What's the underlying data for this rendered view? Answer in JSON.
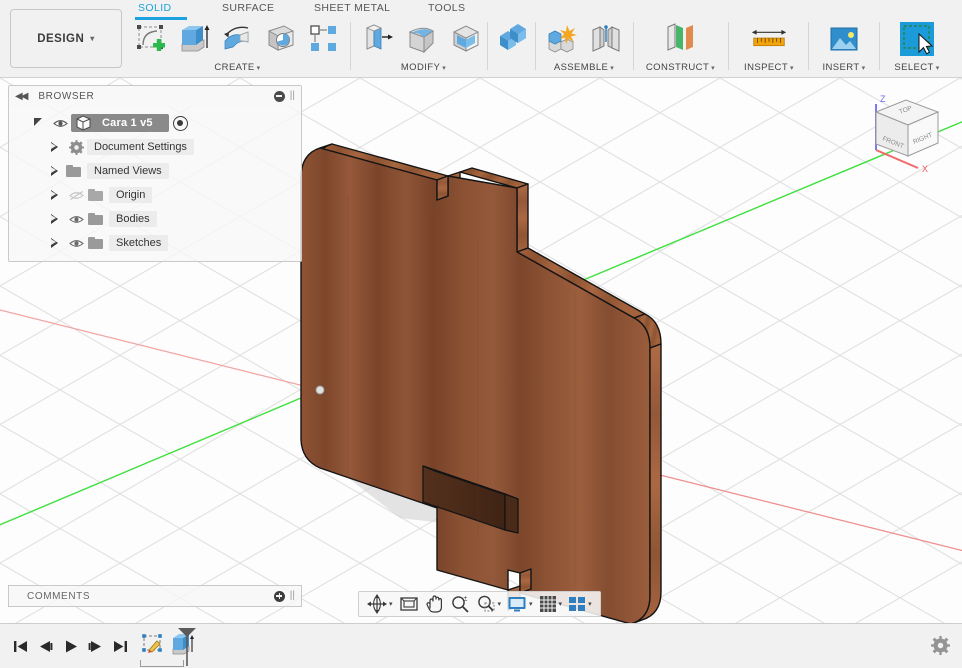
{
  "app": {
    "design_button_label": "DESIGN",
    "caret": "▾"
  },
  "ribbon": {
    "tabs": [
      {
        "label": "SOLID",
        "active": true
      },
      {
        "label": "SURFACE",
        "active": false
      },
      {
        "label": "SHEET METAL",
        "active": false
      },
      {
        "label": "TOOLS",
        "active": false
      }
    ],
    "groups": [
      {
        "label": "CREATE",
        "caret": "▾",
        "icons": [
          "create-sketch-icon",
          "extrude-icon",
          "revolve-icon",
          "sweep-icon",
          "pattern-icon"
        ]
      },
      {
        "label": "MODIFY",
        "caret": "▾",
        "icons": [
          "press-pull-icon",
          "fillet-icon",
          "shell-icon"
        ]
      },
      {
        "label": "ASSEMBLE",
        "caret": "▾",
        "icons": [
          "combine-icon",
          "new-component-icon",
          "joint-icon"
        ]
      },
      {
        "label": "CONSTRUCT",
        "caret": "▾",
        "icons": [
          "offset-plane-icon"
        ]
      },
      {
        "label": "INSPECT",
        "caret": "▾",
        "icons": [
          "measure-icon"
        ]
      },
      {
        "label": "INSERT",
        "caret": "▾",
        "icons": [
          "insert-image-icon"
        ]
      },
      {
        "label": "SELECT",
        "caret": "▾",
        "icons": [
          "select-window-icon"
        ]
      }
    ]
  },
  "browser": {
    "collapse_icon": "collapse-left-icon",
    "title": "BROWSER",
    "minimize_icon": "minimize-icon",
    "root": {
      "name": "Cara 1 v5",
      "visibility_icon": "eye-icon",
      "activate_icon": "activate-radio-icon"
    },
    "items": [
      {
        "label": "Document Settings",
        "icon": "gear-icon",
        "has_eye": false,
        "eye_state": "none"
      },
      {
        "label": "Named Views",
        "icon": "folder-icon",
        "has_eye": false,
        "eye_state": "none"
      },
      {
        "label": "Origin",
        "icon": "folder-icon",
        "has_eye": true,
        "eye_state": "hidden"
      },
      {
        "label": "Bodies",
        "icon": "folder-icon",
        "has_eye": true,
        "eye_state": "visible"
      },
      {
        "label": "Sketches",
        "icon": "folder-icon",
        "has_eye": true,
        "eye_state": "visible"
      }
    ]
  },
  "comments": {
    "title": "COMMENTS",
    "add_icon": "add-comment-icon"
  },
  "navbar": {
    "items": [
      {
        "name": "orbit-icon",
        "has_caret": true
      },
      {
        "name": "look-at-icon",
        "has_caret": false
      },
      {
        "name": "pan-icon",
        "has_caret": false
      },
      {
        "name": "zoom-icon",
        "has_caret": false
      },
      {
        "name": "fit-icon",
        "has_caret": true
      },
      {
        "name": "display-settings-icon",
        "has_caret": true
      },
      {
        "name": "grid-snaps-icon",
        "has_caret": true
      },
      {
        "name": "viewport-layout-icon",
        "has_caret": true
      }
    ]
  },
  "viewcube": {
    "faces": [
      "TOP",
      "FRONT",
      "RIGHT"
    ],
    "axis_labels": [
      "Z",
      "X"
    ],
    "z_axis_color": "#6d6df0",
    "x_axis_color": "#f05a5a"
  },
  "viewport": {
    "background_color": "#fdfdfd",
    "grid_color": "#dcdcdc",
    "x_axis_color": "#f08a8a",
    "y_axis_color": "#3ee03e",
    "ground_shadow_color": "#c6c6c6",
    "model": {
      "name": "wood-board-body",
      "material": "wood",
      "face_color_front": "#8a4f31",
      "face_color_top": "#b4apple",
      "edge_color": "#1a1a1a"
    }
  },
  "timeline": {
    "controls": [
      {
        "name": "go-to-beginning-button",
        "glyph": "|◀"
      },
      {
        "name": "step-back-button",
        "glyph": "◀|"
      },
      {
        "name": "play-button",
        "glyph": "▶"
      },
      {
        "name": "step-forward-button",
        "glyph": "|▶"
      },
      {
        "name": "go-to-end-button",
        "glyph": "▶|"
      }
    ],
    "features": [
      {
        "name": "timeline-feature-sketch",
        "icon": "sketch-feature-icon"
      },
      {
        "name": "timeline-feature-extrude",
        "icon": "extrude-feature-icon"
      }
    ],
    "marker_name": "timeline-end-marker",
    "settings_icon": "gear-icon"
  }
}
